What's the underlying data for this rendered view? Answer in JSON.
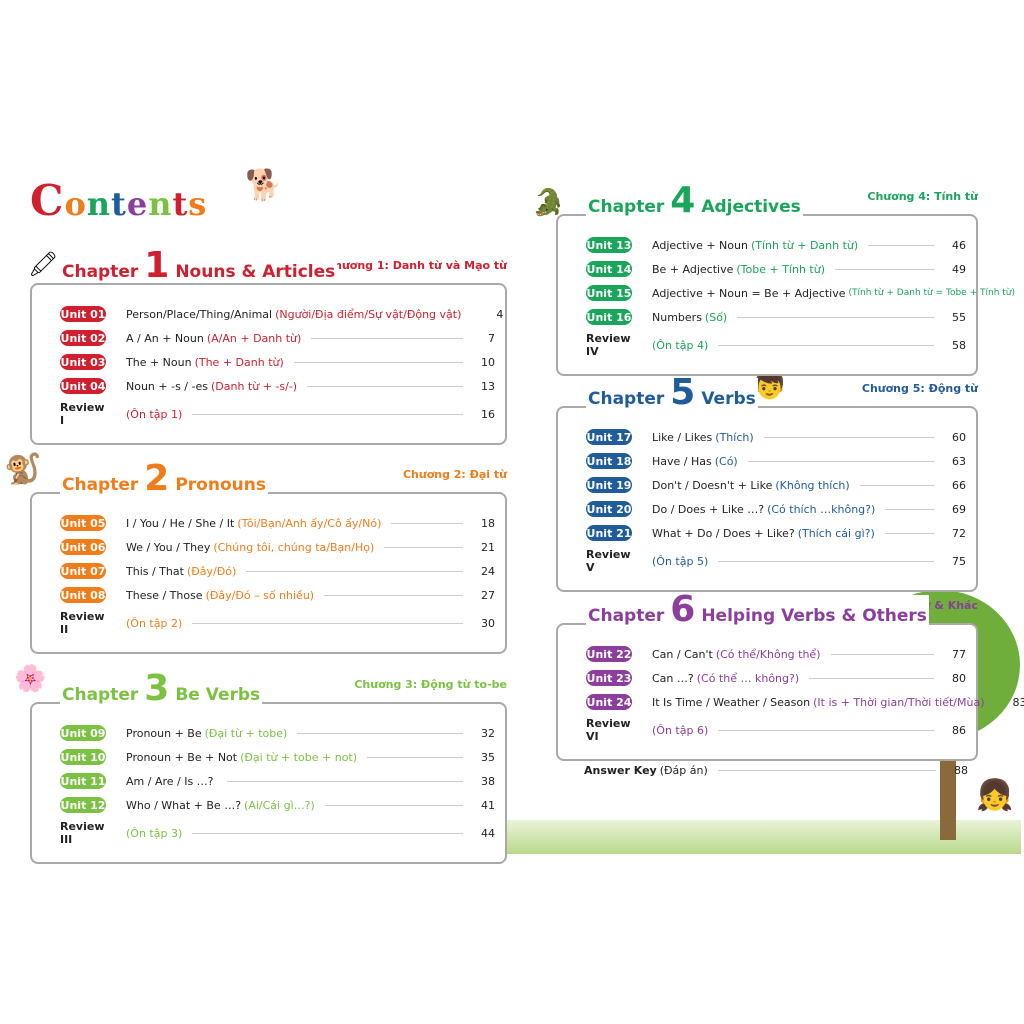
{
  "page_title": "CONTENTS",
  "chapters": [
    {
      "label": "Chapter",
      "number": "1",
      "name": "Nouns & Articles",
      "vn_title": "Chương 1: Danh từ và Mạo từ",
      "color": "#d0202f",
      "units": [
        {
          "unit": "Unit 01",
          "title": "Person/Place/Thing/Animal",
          "vn": "(Người/Địa điểm/Sự vật/Động vật)",
          "page": "4"
        },
        {
          "unit": "Unit 02",
          "title": "A / An + Noun",
          "vn": "(A/An + Danh từ)",
          "page": "7"
        },
        {
          "unit": "Unit 03",
          "title": "The + Noun",
          "vn": "(The + Danh từ)",
          "page": "10"
        },
        {
          "unit": "Unit 04",
          "title": "Noun + -s / -es",
          "vn": "(Danh từ + -s/-)",
          "page": "13"
        }
      ],
      "review": {
        "label": "Review I",
        "vn": "(Ôn tập 1)",
        "page": "16"
      }
    },
    {
      "label": "Chapter",
      "number": "2",
      "name": "Pronouns",
      "vn_title": "Chương 2: Đại từ",
      "color": "#f07d1a",
      "units": [
        {
          "unit": "Unit 05",
          "title": "I / You / He / She / It",
          "vn": "(Tôi/Bạn/Anh ấy/Cô ấy/Nó)",
          "page": "18"
        },
        {
          "unit": "Unit 06",
          "title": "We / You / They",
          "vn": "(Chúng tôi, chúng ta/Bạn/Họ)",
          "page": "21"
        },
        {
          "unit": "Unit 07",
          "title": "This / That",
          "vn": "(Đây/Đó)",
          "page": "24"
        },
        {
          "unit": "Unit 08",
          "title": "These / Those",
          "vn": "(Đây/Đó – số nhiều)",
          "page": "27"
        }
      ],
      "review": {
        "label": "Review II",
        "vn": "(Ôn tập 2)",
        "page": "30"
      }
    },
    {
      "label": "Chapter",
      "number": "3",
      "name": "Be Verbs",
      "vn_title": "Chương 3: Động từ to-be",
      "color": "#7cc242",
      "units": [
        {
          "unit": "Unit 09",
          "title": "Pronoun + Be",
          "vn": "(Đại từ + tobe)",
          "page": "32"
        },
        {
          "unit": "Unit 10",
          "title": "Pronoun + Be + Not",
          "vn": "(Đại từ + tobe + not)",
          "page": "35"
        },
        {
          "unit": "Unit 11",
          "title": "Am / Are / Is …?",
          "vn": "",
          "page": "38"
        },
        {
          "unit": "Unit 12",
          "title": "Who / What + Be …?",
          "vn": "(Ai/Cái gì…?)",
          "page": "41"
        }
      ],
      "review": {
        "label": "Review III",
        "vn": "(Ôn tập 3)",
        "page": "44"
      }
    },
    {
      "label": "Chapter",
      "number": "4",
      "name": "Adjectives",
      "vn_title": "Chương 4: Tính từ",
      "color": "#1aa65a",
      "units": [
        {
          "unit": "Unit 13",
          "title": "Adjective + Noun",
          "vn": "(Tính từ + Danh từ)",
          "page": "46"
        },
        {
          "unit": "Unit 14",
          "title": "Be + Adjective",
          "vn": "(Tobe + Tính từ)",
          "page": "49"
        },
        {
          "unit": "Unit 15",
          "title": "Adjective + Noun = Be + Adjective",
          "vn": "(Tính từ + Danh từ = Tobe + Tính từ)",
          "page": "52"
        },
        {
          "unit": "Unit 16",
          "title": "Numbers",
          "vn": "(Số)",
          "page": "55"
        }
      ],
      "review": {
        "label": "Review IV",
        "vn": "(Ôn tập 4)",
        "page": "58"
      }
    },
    {
      "label": "Chapter",
      "number": "5",
      "name": "Verbs",
      "vn_title": "Chương 5: Động từ",
      "color": "#1f5c99",
      "units": [
        {
          "unit": "Unit 17",
          "title": "Like / Likes",
          "vn": "(Thích)",
          "page": "60"
        },
        {
          "unit": "Unit 18",
          "title": "Have / Has",
          "vn": "(Có)",
          "page": "63"
        },
        {
          "unit": "Unit 19",
          "title": "Don't / Doesn't + Like",
          "vn": "(Không thích)",
          "page": "66"
        },
        {
          "unit": "Unit 20",
          "title": "Do / Does + Like …?",
          "vn": "(Có thích …không?)",
          "page": "69"
        },
        {
          "unit": "Unit 21",
          "title": "What + Do / Does + Like?",
          "vn": "(Thích cái gì?)",
          "page": "72"
        }
      ],
      "review": {
        "label": "Review V",
        "vn": "(Ôn tập 5)",
        "page": "75"
      }
    },
    {
      "label": "Chapter",
      "number": "6",
      "name": "Helping Verbs & Others",
      "vn_title": "Chương 6: Trợ động từ & Khác",
      "color": "#8b3e9b",
      "units": [
        {
          "unit": "Unit 22",
          "title": "Can / Can't",
          "vn": "(Có thể/Không thể)",
          "page": "77"
        },
        {
          "unit": "Unit 23",
          "title": "Can …?",
          "vn": "(Có thể … không?)",
          "page": "80"
        },
        {
          "unit": "Unit 24",
          "title": "It Is Time / Weather / Season",
          "vn": "(It is + Thời gian/Thời tiết/Mùa)",
          "page": "83"
        }
      ],
      "review": {
        "label": "Review VI",
        "vn": "(Ôn tập 6)",
        "page": "86"
      }
    }
  ],
  "answer_key": {
    "label": "Answer Key",
    "vn": "(Đáp án)",
    "page": "88"
  }
}
